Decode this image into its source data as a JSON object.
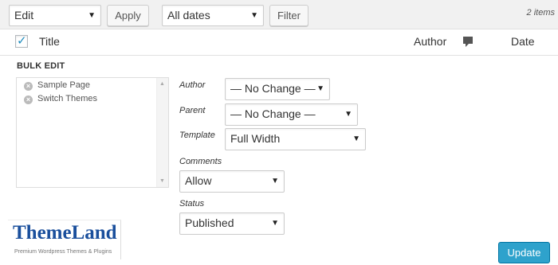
{
  "toolbar": {
    "bulk_action": "Edit",
    "apply_label": "Apply",
    "dates_filter": "All dates",
    "filter_label": "Filter",
    "item_count": "2 items"
  },
  "table_header": {
    "title": "Title",
    "author": "Author",
    "date": "Date"
  },
  "bulk_edit": {
    "heading": "BULK EDIT",
    "items": [
      "Sample Page",
      "Switch Themes"
    ],
    "fields": {
      "author_label": "Author",
      "author_value": "— No Change —",
      "parent_label": "Parent",
      "parent_value": "— No Change —",
      "template_label": "Template",
      "template_value": "Full Width",
      "comments_label": "Comments",
      "comments_value": "Allow",
      "status_label": "Status",
      "status_value": "Published"
    },
    "update_label": "Update"
  },
  "watermark": {
    "brand": "ThemeLand",
    "tagline": "Premium Wordpress Themes & Plugins"
  },
  "colors": {
    "accent": "#2ea2cc",
    "brand": "#1a4f9c"
  }
}
